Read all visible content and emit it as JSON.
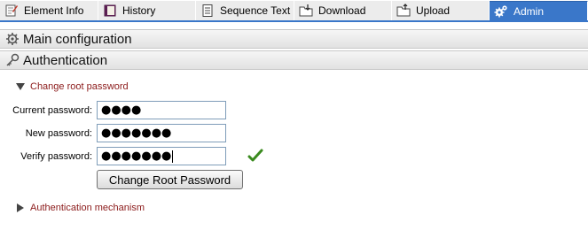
{
  "tabs": [
    {
      "label": "Element Info",
      "icon": "element-info-icon",
      "active": false
    },
    {
      "label": "History",
      "icon": "history-book-icon",
      "active": false
    },
    {
      "label": "Sequence Text",
      "icon": "document-icon",
      "active": false
    },
    {
      "label": "Download",
      "icon": "folder-download-icon",
      "active": false
    },
    {
      "label": "Upload",
      "icon": "folder-upload-icon",
      "active": false
    },
    {
      "label": "Admin",
      "icon": "admin-gears-icon",
      "active": true
    }
  ],
  "sections": {
    "main_config": {
      "title": "Main configuration",
      "icon": "gear-icon"
    },
    "authentication": {
      "title": "Authentication",
      "icon": "key-icon"
    }
  },
  "change_root": {
    "label": "Change root password",
    "expanded": true,
    "fields": {
      "current": {
        "label": "Current password:",
        "value": "●●●●"
      },
      "new": {
        "label": "New password:",
        "value": "●●●●●●●"
      },
      "verify": {
        "label": "Verify password:",
        "value": "●●●●●●●"
      }
    },
    "verify_status": "match",
    "button_label": "Change Root Password"
  },
  "auth_mechanism": {
    "label": "Authentication mechanism",
    "expanded": false
  },
  "colors": {
    "active_tab": "#3a77c9",
    "expander_text": "#8b1a1a",
    "check": "#3a8a1e"
  }
}
